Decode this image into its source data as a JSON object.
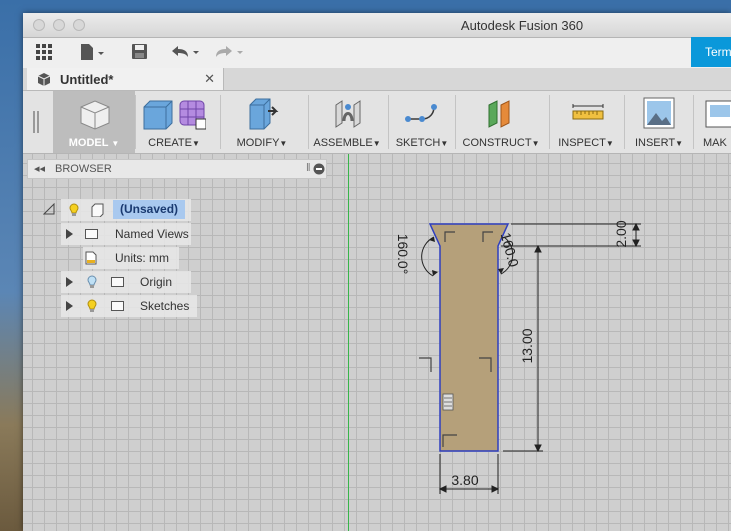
{
  "window": {
    "title": "Autodesk Fusion 360",
    "term_button": "Term"
  },
  "document_tab": {
    "label": "Untitled*",
    "close": "✕"
  },
  "ribbon": {
    "groups": [
      {
        "label": "MODEL",
        "icon": "model-cube-icon"
      },
      {
        "label": "CREATE",
        "icon": "create-box-icon"
      },
      {
        "label": "MODIFY",
        "icon": "modify-press-pull-icon"
      },
      {
        "label": "ASSEMBLE",
        "icon": "assemble-joint-icon"
      },
      {
        "label": "SKETCH",
        "icon": "sketch-curve-icon"
      },
      {
        "label": "CONSTRUCT",
        "icon": "construct-plane-icon"
      },
      {
        "label": "INSPECT",
        "icon": "inspect-ruler-icon"
      },
      {
        "label": "INSERT",
        "icon": "insert-image-icon"
      },
      {
        "label": "MAK",
        "icon": "make-icon"
      }
    ]
  },
  "browser": {
    "title": "BROWSER",
    "root_label": "(Unsaved)",
    "items": [
      {
        "label": "Named Views"
      },
      {
        "label": "Units: mm"
      },
      {
        "label": "Origin"
      },
      {
        "label": "Sketches"
      }
    ]
  },
  "sketch": {
    "dimensions": {
      "top_height": "2.00",
      "main_height": "13.00",
      "width": "3.80",
      "left_angle": "160.0°",
      "right_angle": "160.0"
    },
    "profile_fill": "#b5a07a",
    "profile_stroke": "#2f3fbf"
  },
  "colors": {
    "accent": "#0a98da",
    "selection": "#a9c9ef",
    "origin_axis": "#38b54a"
  }
}
